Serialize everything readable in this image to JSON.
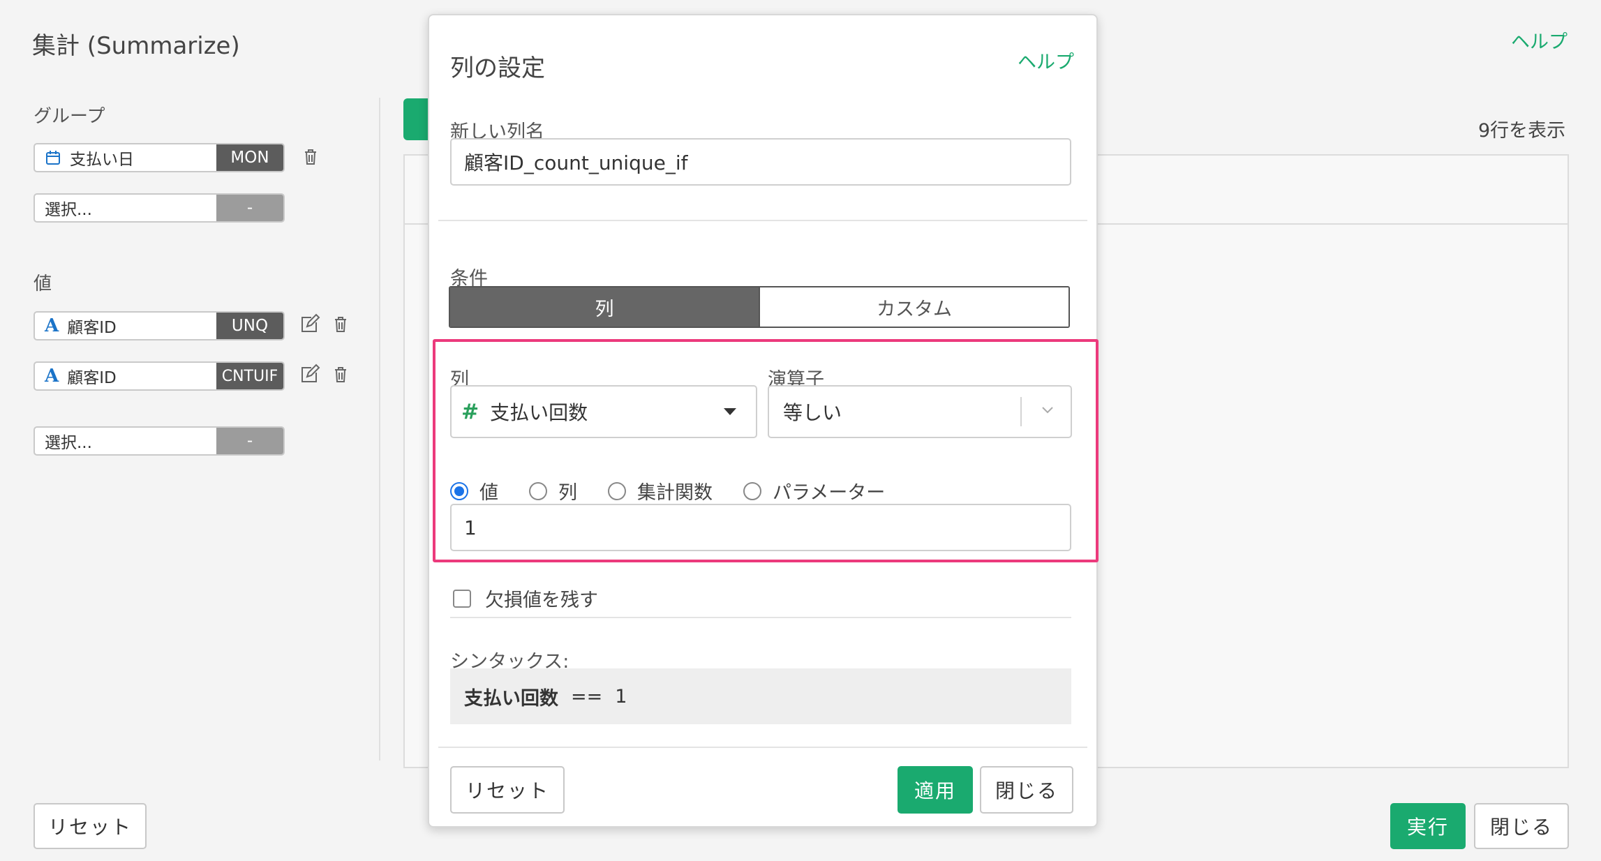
{
  "page": {
    "title": "集計 (Summarize)",
    "help_label": "ヘルプ",
    "rows_count": "9行を表示"
  },
  "sidebar": {
    "group_label": "グループ",
    "groups": [
      {
        "field": "支払い日",
        "tag": "MON",
        "icon": "calendar-icon"
      },
      {
        "field": "選択...",
        "tag": "-"
      }
    ],
    "values_label": "値",
    "values": [
      {
        "field": "顧客ID",
        "tag": "UNQ",
        "icon": "text-type-icon"
      },
      {
        "field": "顧客ID",
        "tag": "CNTUIF",
        "icon": "text-type-icon"
      },
      {
        "field": "選択...",
        "tag": "-"
      }
    ],
    "text_type_glyph": "A",
    "reset_label": "リセット"
  },
  "footer": {
    "run_label": "実行",
    "close_label": "閉じる"
  },
  "modal": {
    "title": "列の設定",
    "help_label": "ヘルプ",
    "new_column_label": "新しい列名",
    "new_column_value": "顧客ID_count_unique_if",
    "condition_label": "条件",
    "tabs": [
      {
        "label": "列",
        "active": true
      },
      {
        "label": "カスタム",
        "active": false
      }
    ],
    "column_label": "列",
    "column_value": "支払い回数",
    "column_type_glyph": "#",
    "operator_label": "演算子",
    "operator_value": "等しい",
    "radio_options": [
      {
        "label": "値",
        "checked": true
      },
      {
        "label": "列",
        "checked": false
      },
      {
        "label": "集計関数",
        "checked": false
      },
      {
        "label": "パラメーター",
        "checked": false
      }
    ],
    "value_input": "1",
    "keep_missing_label": "欠損値を残す",
    "syntax_label": "シンタックス:",
    "syntax": {
      "column": "支払い回数",
      "operator": "==",
      "value": "1"
    },
    "reset_label": "リセット",
    "apply_label": "適用",
    "close_label": "閉じる"
  },
  "colors": {
    "accent": "#1aaa6f",
    "highlight": "#ec3a7c",
    "tag_bg": "#5c5c5c",
    "radio_checked": "#1a73e8"
  }
}
